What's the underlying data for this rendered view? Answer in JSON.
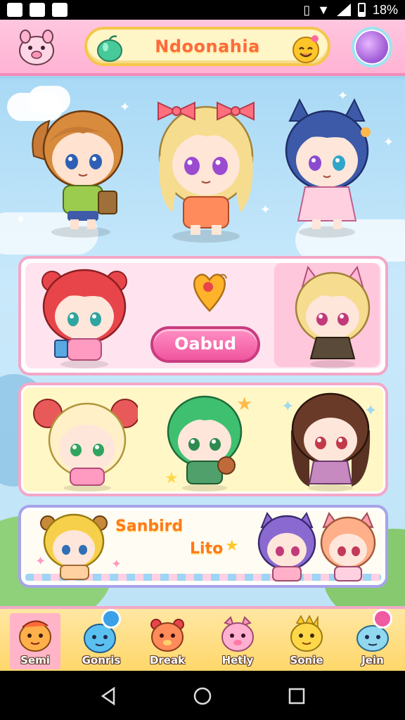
{
  "status_bar": {
    "battery_text": "18%",
    "icons": [
      "notification-icon",
      "cloud-icon",
      "image-icon",
      "vibrate-icon",
      "wifi-icon",
      "signal-icon",
      "battery-icon"
    ]
  },
  "header": {
    "title": "Ndoonahia",
    "left_icon": "pig-mascot-icon",
    "title_left_icon": "green-apple-icon",
    "title_right_icon": "smiley-icon",
    "right_button_icon": "purple-orb-icon"
  },
  "heroes": [
    {
      "name": "hero-brown-ponytail",
      "hair": "#c77a35",
      "outfit": "#9ccc4e"
    },
    {
      "name": "hero-blonde-bows",
      "hair": "#f6dc8e",
      "outfit": "#ff8a5c"
    },
    {
      "name": "hero-blue-cat",
      "hair": "#3c5aa8",
      "outfit": "#ffd0e0"
    }
  ],
  "panel1": {
    "button_label": "Oabud",
    "pin_icon": "heart-pin-icon"
  },
  "panel2": {
    "characters": [
      "cream-bun-girl",
      "green-hair-girl",
      "brown-hair-girl"
    ]
  },
  "panel3": {
    "label_1": "Sanbird",
    "label_2": "Lito"
  },
  "bottom_nav": {
    "items": [
      {
        "label": "Semi",
        "icon": "orange-bird-icon",
        "active": true
      },
      {
        "label": "Gonris",
        "icon": "blue-blob-icon",
        "active": false
      },
      {
        "label": "Dreak",
        "icon": "red-bear-icon",
        "active": false
      },
      {
        "label": "Hetly",
        "icon": "pink-pig-icon",
        "active": false
      },
      {
        "label": "Sonie",
        "icon": "yellow-chick-icon",
        "active": false
      },
      {
        "label": "Jein",
        "icon": "cyan-blob-icon",
        "active": false
      }
    ]
  },
  "colors": {
    "header_pink": "#ffb3d4",
    "title_orange": "#ff6a3d",
    "cta_pink": "#f0559e",
    "nav_yellow": "#ffd76a"
  }
}
